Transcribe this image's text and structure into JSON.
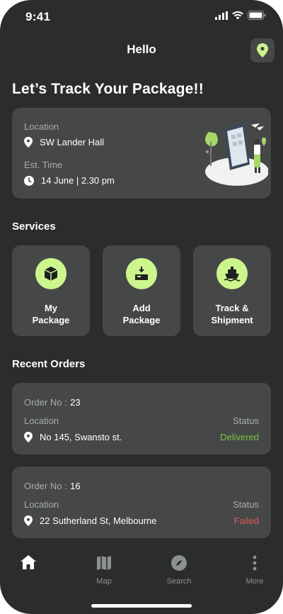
{
  "status": {
    "time": "9:41"
  },
  "header": {
    "title": "Hello",
    "location_icon": "location-pin-icon"
  },
  "headline": "Let’s Track Your Package!!",
  "tracking": {
    "location_label": "Location",
    "location_value": "SW Lander Hall",
    "time_label": "Est. Time",
    "time_value": "14 June | 2.30 pm"
  },
  "services": {
    "title": "Services",
    "items": [
      {
        "label": "My\nPackage",
        "icon": "package-icon"
      },
      {
        "label": "Add\nPackage",
        "icon": "add-box-icon"
      },
      {
        "label": "Track &\nShipment",
        "icon": "ship-icon"
      }
    ]
  },
  "recent": {
    "title": "Recent Orders",
    "orders": [
      {
        "order_label": "Order No :",
        "order_no": "23",
        "location_label": "Location",
        "status_label": "Status",
        "address": "No 145, Swansto st.",
        "status": "Delivered"
      },
      {
        "order_label": "Order No :",
        "order_no": "16",
        "location_label": "Location",
        "status_label": "Status",
        "address": "22 Sutherland St, Melbourne",
        "status": "Failed"
      }
    ]
  },
  "tabbar": {
    "map": "Map",
    "search": "Search",
    "more": "More"
  },
  "colors": {
    "accent": "#cdf58d",
    "delivered": "#7cc142",
    "failed": "#e0585b",
    "card": "#454846",
    "background": "#2b2d2c"
  }
}
